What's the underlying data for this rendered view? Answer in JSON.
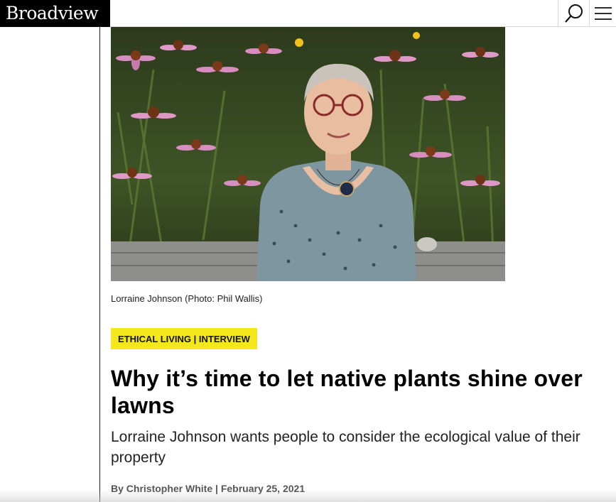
{
  "header": {
    "logo_text": "Broadview",
    "search_icon": "search-icon",
    "menu_icon": "hamburger-menu-icon"
  },
  "article": {
    "photo_caption": "Lorraine Johnson (Photo: Phil Wallis)",
    "category": "ETHICAL LIVING | INTERVIEW",
    "title": "Why it’s time to let native plants shine over lawns",
    "dek": "Lorraine Johnson wants people to consider the ecological value of their property",
    "byline": "By Christopher White | February 25, 2021"
  },
  "colors": {
    "logo_bg": "#000000",
    "category_bg": "#f4e71c"
  }
}
